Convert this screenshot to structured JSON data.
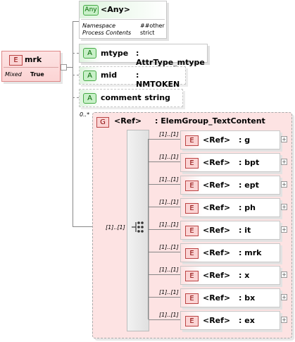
{
  "root": {
    "badge": "E",
    "name": "mrk",
    "prop_label": "Mixed",
    "prop_value": "True"
  },
  "any": {
    "badge": "Any",
    "title": "<Any>",
    "ns_label": "Namespace",
    "ns_value": "##other",
    "pc_label": "Process Contents",
    "pc_value": "strict"
  },
  "attributes": [
    {
      "badge": "A",
      "name": "mtype",
      "type": ": AttrType_mtype"
    },
    {
      "badge": "A",
      "name": "mid",
      "type": ": NMTOKEN"
    },
    {
      "badge": "A",
      "name": "comment",
      "type": ": string"
    }
  ],
  "group": {
    "badge": "G",
    "ref": "<Ref>",
    "name": ": ElemGroup_TextContent",
    "cardinality": "0..*",
    "choice_cardinality": "[1]..[1]"
  },
  "elements": [
    {
      "badge": "E",
      "ref": "<Ref>",
      "name": ": g",
      "card": "[1]..[1]",
      "expandable": true
    },
    {
      "badge": "E",
      "ref": "<Ref>",
      "name": ": bpt",
      "card": "[1]..[1]",
      "expandable": true
    },
    {
      "badge": "E",
      "ref": "<Ref>",
      "name": ": ept",
      "card": "[1]..[1]",
      "expandable": true
    },
    {
      "badge": "E",
      "ref": "<Ref>",
      "name": ": ph",
      "card": "[1]..[1]",
      "expandable": true
    },
    {
      "badge": "E",
      "ref": "<Ref>",
      "name": ": it",
      "card": "[1]..[1]",
      "expandable": true
    },
    {
      "badge": "E",
      "ref": "<Ref>",
      "name": ": mrk",
      "card": "[1]..[1]",
      "expandable": false
    },
    {
      "badge": "E",
      "ref": "<Ref>",
      "name": ": x",
      "card": "[1]..[1]",
      "expandable": true
    },
    {
      "badge": "E",
      "ref": "<Ref>",
      "name": ": bx",
      "card": "[1]..[1]",
      "expandable": true
    },
    {
      "badge": "E",
      "ref": "<Ref>",
      "name": ": ex",
      "card": "[1]..[1]",
      "expandable": true
    }
  ]
}
